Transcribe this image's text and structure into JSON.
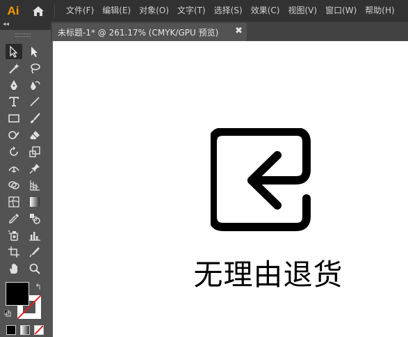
{
  "app": {
    "logo": "Ai"
  },
  "menubar": {
    "items": [
      "文件(F)",
      "编辑(E)",
      "对象(O)",
      "文字(T)",
      "选择(S)",
      "效果(C)",
      "视图(V)",
      "窗口(W)",
      "帮助(H)"
    ]
  },
  "toolbox": {
    "collapse_glyph": "◂◂",
    "swap_glyph": "↰"
  },
  "document": {
    "tab_title": "未标题-1* @ 261.17% (CMYK/GPU 预览)",
    "close_glyph": "✖"
  },
  "artwork": {
    "caption": "无理由退货"
  },
  "icons": {
    "home": "home-icon",
    "close": "close-icon",
    "return": "return-arrow-icon"
  },
  "colors": {
    "app_bg": "#535353",
    "menubar": "#323232",
    "logo": "#ff9a00",
    "canvas": "#ffffff",
    "artwork": "#000000"
  }
}
